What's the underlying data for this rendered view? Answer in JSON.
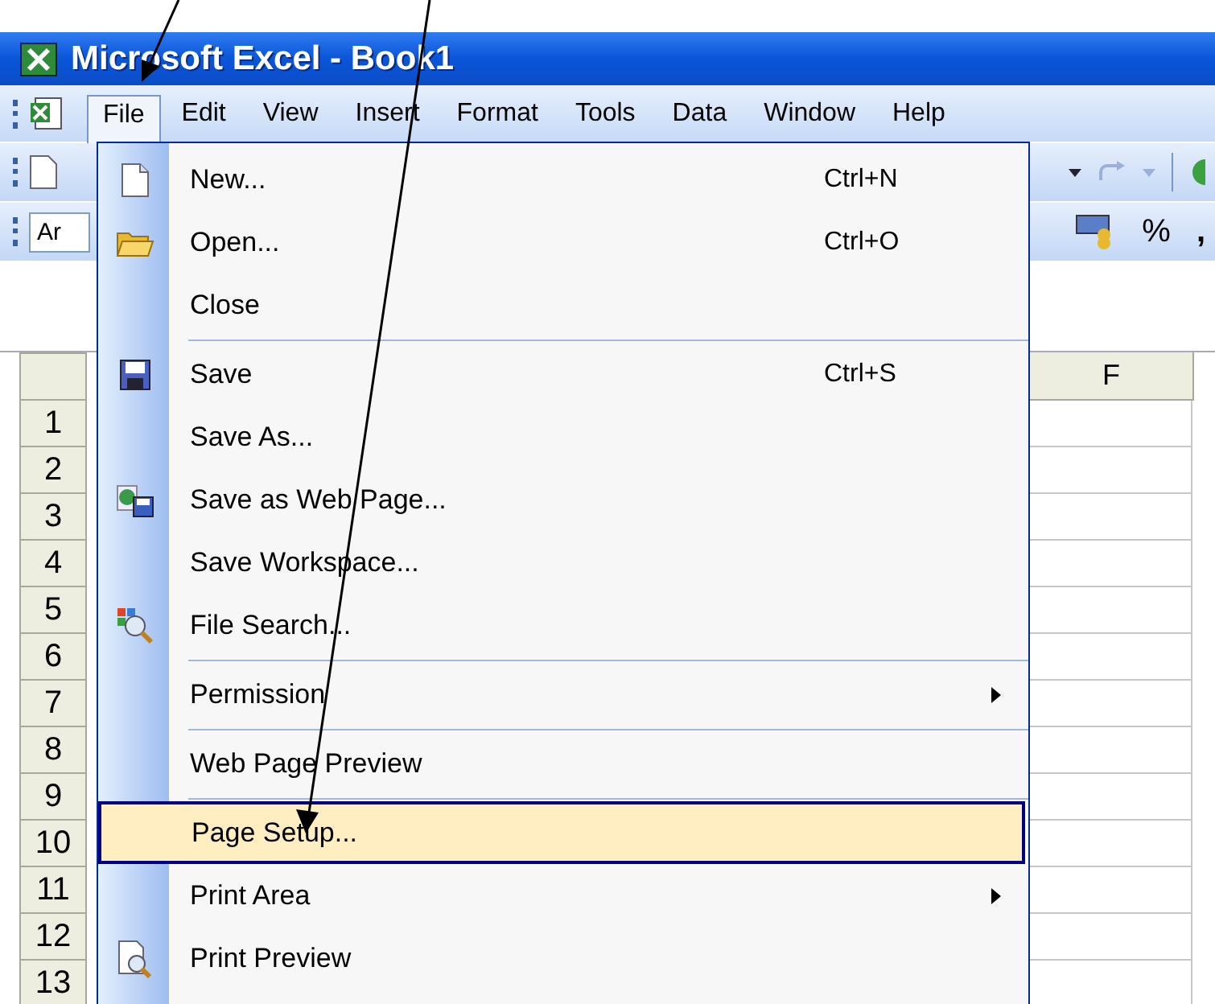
{
  "window": {
    "title": "Microsoft Excel - Book1"
  },
  "menu_bar": [
    {
      "label": "File",
      "selected": true
    },
    {
      "label": "Edit",
      "selected": false
    },
    {
      "label": "View",
      "selected": false
    },
    {
      "label": "Insert",
      "selected": false
    },
    {
      "label": "Format",
      "selected": false
    },
    {
      "label": "Tools",
      "selected": false
    },
    {
      "label": "Data",
      "selected": false
    },
    {
      "label": "Window",
      "selected": false
    },
    {
      "label": "Help",
      "selected": false
    }
  ],
  "toolbar": {
    "font_field": "Ar",
    "percent": "%",
    "comma": ","
  },
  "sheet": {
    "columns": [
      "F"
    ],
    "rows": [
      "1",
      "2",
      "3",
      "4",
      "5",
      "6",
      "7",
      "8",
      "9",
      "10",
      "11",
      "12",
      "13"
    ]
  },
  "file_menu": {
    "items": [
      {
        "kind": "item",
        "label": "New...",
        "shortcut": "Ctrl+N",
        "submenu": false,
        "selected": false
      },
      {
        "kind": "item",
        "label": "Open...",
        "shortcut": "Ctrl+O",
        "submenu": false,
        "selected": false
      },
      {
        "kind": "item",
        "label": "Close",
        "submenu": false,
        "selected": false
      },
      {
        "kind": "separator"
      },
      {
        "kind": "item",
        "label": "Save",
        "shortcut": "Ctrl+S",
        "submenu": false,
        "selected": false
      },
      {
        "kind": "item",
        "label": "Save As...",
        "submenu": false,
        "selected": false
      },
      {
        "kind": "item",
        "label": "Save as Web Page...",
        "submenu": false,
        "selected": false
      },
      {
        "kind": "item",
        "label": "Save Workspace...",
        "submenu": false,
        "selected": false
      },
      {
        "kind": "item",
        "label": "File Search...",
        "submenu": false,
        "selected": false
      },
      {
        "kind": "separator"
      },
      {
        "kind": "item",
        "label": "Permission",
        "submenu": true,
        "selected": false
      },
      {
        "kind": "separator"
      },
      {
        "kind": "item",
        "label": "Web Page Preview",
        "submenu": false,
        "selected": false
      },
      {
        "kind": "separator"
      },
      {
        "kind": "item",
        "label": "Page Setup...",
        "submenu": false,
        "selected": true
      },
      {
        "kind": "item",
        "label": "Print Area",
        "submenu": true,
        "selected": false
      },
      {
        "kind": "item",
        "label": "Print Preview",
        "submenu": false,
        "selected": false
      }
    ]
  }
}
